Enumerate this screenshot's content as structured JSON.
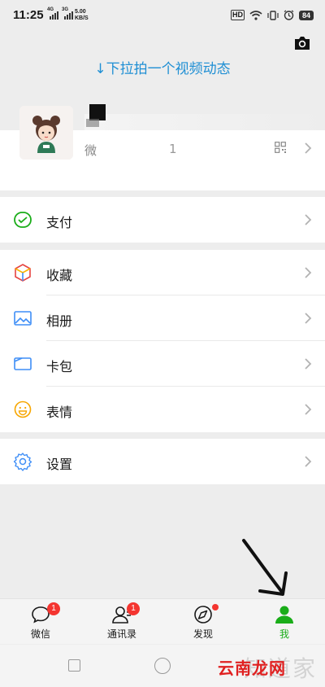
{
  "status_bar": {
    "time": "11:25",
    "signal_1": "4G",
    "signal_2": "3G",
    "net_speed_value": "5.00",
    "net_speed_unit": "KB/S",
    "hd_label": "HD",
    "battery": "84"
  },
  "pull_hint": "↓下拉拍一个视频动态",
  "profile": {
    "wechat_id_prefix": "微",
    "wechat_id_suffix": "1"
  },
  "sections": {
    "pay": {
      "label": "支付"
    },
    "favorites": {
      "label": "收藏"
    },
    "album": {
      "label": "相册"
    },
    "cards": {
      "label": "卡包"
    },
    "stickers": {
      "label": "表情"
    },
    "settings": {
      "label": "设置"
    }
  },
  "tabs": [
    {
      "label": "微信",
      "badge": "1",
      "icon": "chat-icon"
    },
    {
      "label": "通讯录",
      "badge": "1",
      "icon": "contacts-icon"
    },
    {
      "label": "发现",
      "icon": "compass-icon"
    },
    {
      "label": "我",
      "icon": "person-icon"
    }
  ],
  "watermark": {
    "text": "云南龙网",
    "faint_text": "知道家"
  },
  "colors": {
    "accent_green": "#1aad19",
    "hint_blue": "#1f8fd4",
    "badge_red": "#f43530"
  }
}
